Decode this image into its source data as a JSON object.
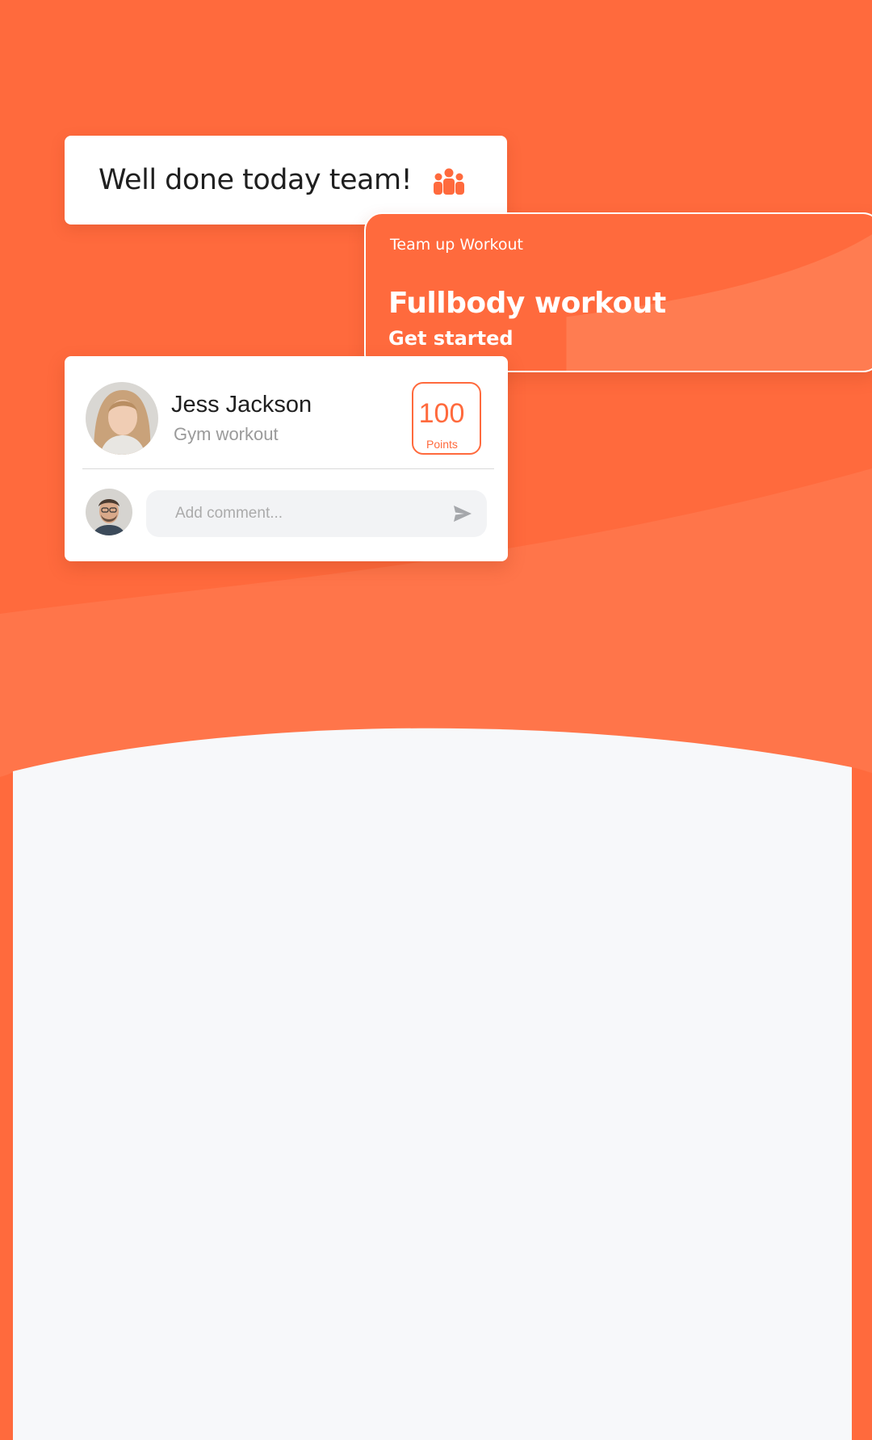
{
  "colors": {
    "accent": "#ff6a3d",
    "background_bottom": "#f7f8fa"
  },
  "message_card": {
    "text": "Well done today team!",
    "icon": "team-icon"
  },
  "workout_card": {
    "label": "Team up Workout",
    "title": "Fullbody workout",
    "cta": "Get started"
  },
  "post": {
    "name": "Jess Jackson",
    "subtitle": "Gym workout",
    "points_value": "100",
    "points_unit": "Points",
    "comment_placeholder": "Add comment...",
    "send_icon": "send-icon"
  }
}
